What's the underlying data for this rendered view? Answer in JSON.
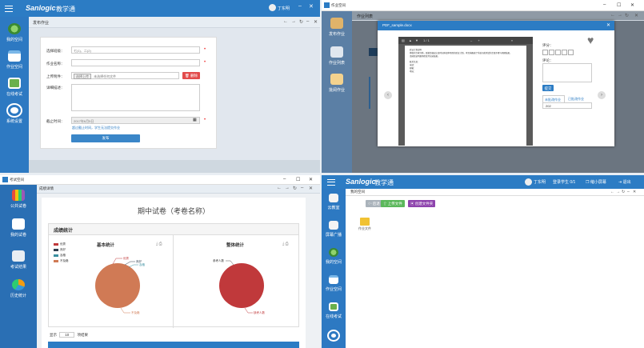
{
  "q1": {
    "logo": "Sanlogic",
    "app_title": "教学通",
    "user_name": "丁东明",
    "tab_title": "发布作业",
    "sidebar": [
      {
        "label": "我的空间"
      },
      {
        "label": "作业空间"
      },
      {
        "label": "在线考试"
      },
      {
        "label": "系统设置"
      }
    ],
    "form": {
      "class_label": "选择班级：",
      "class_value": "七(1)、二(2)",
      "name_label": "作业名称：",
      "attach_label": "上传附件：",
      "choose_btn": "选择上传",
      "no_file": "未选择任何文件",
      "delete_btn": "删除",
      "desc_label": "详细描述：",
      "deadline_label": "截止时间：",
      "deadline_value": "2017年6月5日",
      "hint": "超过截止时间，学生无法提交作业",
      "submit": "发布"
    },
    "colors": {
      "accent": "#2c7cc4",
      "required": "#e33333",
      "delete": "#e24b4b"
    }
  },
  "q2": {
    "window_title": "作业空间",
    "tab_title": "作业列表",
    "sidebar": [
      {
        "label": "发布作业"
      },
      {
        "label": "作业列表"
      },
      {
        "label": "批阅作业"
      }
    ],
    "modal": {
      "title": "PDF_sample.docx",
      "page_indicator": "1 / 1",
      "score_label": "评分：",
      "comment_label": "评论：",
      "submit_btn": "提交",
      "tab_graded": "未批改作业",
      "tab_done": "已批改作业",
      "list_item": "202"
    },
    "doc_lines": [
      "验证计划说明",
      "尊敬的专家评委，感谢您抽出宝贵时间审阅本项目的验证计划。本文档概述了系统功能测试的主要步骤与预期结果，",
      "请按照说明逐项检查并记录结果。",
      "联系信息：",
      "电话：",
      "邮箱：",
      "地址："
    ]
  },
  "q3": {
    "window_title": "考试空间",
    "tab_title": "成绩详情",
    "sidebar": [
      {
        "label": "公共试卷"
      },
      {
        "label": "我的试卷"
      },
      {
        "label": "考试结果"
      },
      {
        "label": "历史统计"
      }
    ],
    "exam_title": "期中试卷（考卷名称）",
    "section_title": "成绩统计",
    "basic_title": "基本统计",
    "overall_title": "整体统计",
    "legend": [
      {
        "label": "优秀",
        "color": "#c0393b"
      },
      {
        "label": "良好",
        "color": "#2f3e4e"
      },
      {
        "label": "及格",
        "color": "#3a8fa0"
      },
      {
        "label": "不及格",
        "color": "#d07a55"
      }
    ],
    "pie1_labels": [
      "优秀",
      "良好",
      "及格",
      "不及格"
    ],
    "pie2_labels": [
      "参考人数",
      "缺考人数"
    ],
    "pie1_color": "#d07a55",
    "pie2_color": "#c0393b",
    "footer_show": "显示",
    "footer_count": "10",
    "footer_suffix": "项结果"
  },
  "q4": {
    "logo": "Sanlogic",
    "app_title": "教学通",
    "user_name": "丁东明",
    "login_info": "登录学生 0/1",
    "shrink_btn": "缩小屏幕",
    "exit_btn": "退出",
    "tab_title": "我的空间",
    "toolbar": {
      "back": "后退",
      "upload": "上传文件",
      "new_folder": "创建文件夹"
    },
    "folder_label": "作业文件",
    "sidebar": [
      {
        "label": "云教室"
      },
      {
        "label": "屏幕广播"
      },
      {
        "label": "我的空间"
      },
      {
        "label": "作业空间"
      },
      {
        "label": "在线考试"
      },
      {
        "label": ""
      }
    ]
  }
}
